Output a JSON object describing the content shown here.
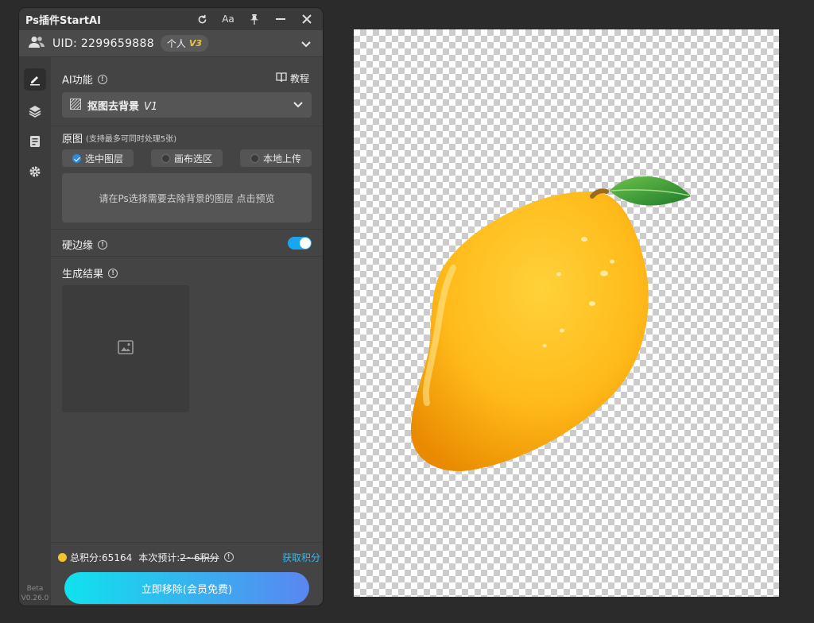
{
  "titlebar": {
    "title": "Ps插件StartAI",
    "icons": [
      "refresh-icon",
      "font-size-icon",
      "pin-icon",
      "minimize-icon",
      "close-icon"
    ],
    "font_label": "Aa"
  },
  "account": {
    "uid_label": "UID: 2299659888",
    "plan": "个人",
    "plan_version": "V3"
  },
  "ai_function": {
    "label": "AI功能",
    "tutorial": "教程",
    "selected_name": "抠图去背景",
    "selected_version": "V1"
  },
  "source": {
    "label": "原图",
    "hint": "(支持最多可同时处理5张)",
    "options": [
      "选中图层",
      "画布选区",
      "本地上传"
    ],
    "selected_index": 0,
    "preview_text": "请在Ps选择需要去除背景的图层 点击预览"
  },
  "hard_edge": {
    "label": "硬边缘",
    "enabled": true
  },
  "result": {
    "label": "生成结果"
  },
  "footer": {
    "total_points": "总积分:65164",
    "estimate_label": "本次预计:",
    "estimate_value": "2~6积分",
    "get_points": "获取积分",
    "cta": "立即移除(会员免费)"
  },
  "sidebar": {
    "beta": "Beta",
    "version": "V0.26.0"
  },
  "colors": {
    "accent": "#1aa5f0",
    "coin": "#f2c230",
    "cta_start": "#10e2ee",
    "cta_end": "#5a86f0"
  }
}
